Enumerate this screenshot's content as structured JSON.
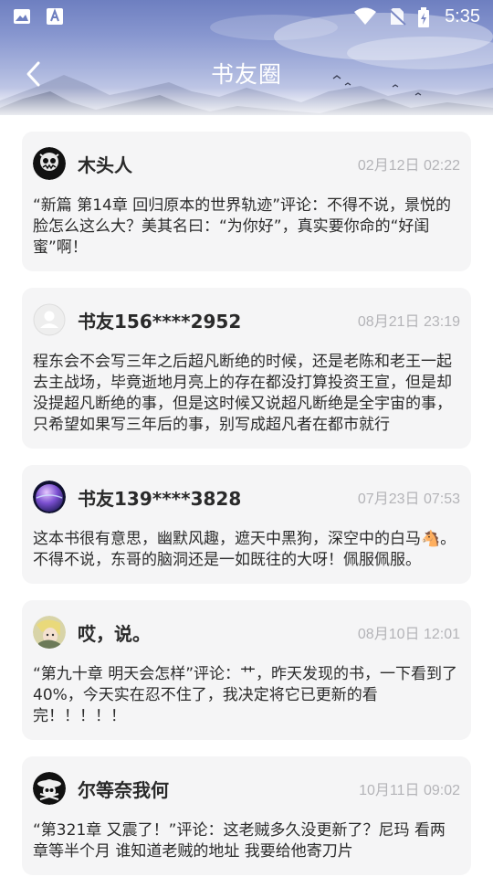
{
  "status_bar": {
    "time": "5:35",
    "left_icons": [
      "image-icon",
      "font-a-icon"
    ],
    "right_icons": [
      "wifi-icon",
      "no-sim-icon",
      "battery-charging-icon"
    ]
  },
  "header": {
    "title": "书友圈",
    "back_icon": "chevron-left-icon"
  },
  "posts": [
    {
      "username": "木头人",
      "time": "02月12日 02:22",
      "avatar": "dark-monster-avatar",
      "content": "“新篇 第14章 回归原本的世界轨迹”评论：不得不说，景悦的脸怎么这么大？美其名曰：“为你好”，真实要你命的“好闺蜜”啊！"
    },
    {
      "username": "书友156****2952",
      "time": "08月21日 23:19",
      "avatar": "default-user-avatar",
      "content": "程东会不会写三年之后超凡断绝的时候，还是老陈和老王一起去主战场，毕竟逝地月亮上的存在都没打算投资王宣，但是却没提超凡断绝的事，但是这时候又说超凡断绝是全宇宙的事，只希望如果写三年后的事，别写成超凡者在都市就行"
    },
    {
      "username": "书友139****3828",
      "time": "07月23日 07:53",
      "avatar": "planet-avatar",
      "content": "这本书很有意思，幽默风趣，遮天中黑狗，深空中的白马🐴。不得不说，东哥的脑洞还是一如既往的大呀！佩服佩服。"
    },
    {
      "username": "哎，说。",
      "time": "08月10日 12:01",
      "avatar": "anime-girl-avatar",
      "content": "“第九十章 明天会怎样”评论：艹，昨天发现的书，一下看到了40%，今天实在忍不住了，我决定将它已更新的看完！！！！！"
    },
    {
      "username": "尔等奈我何",
      "time": "10月11日 09:02",
      "avatar": "straw-hat-skull-avatar",
      "content": "“第321章 又震了！”评论：这老贼多久没更新了？尼玛 看两章等半个月 谁知道老贼的地址 我要给他寄刀片"
    }
  ]
}
